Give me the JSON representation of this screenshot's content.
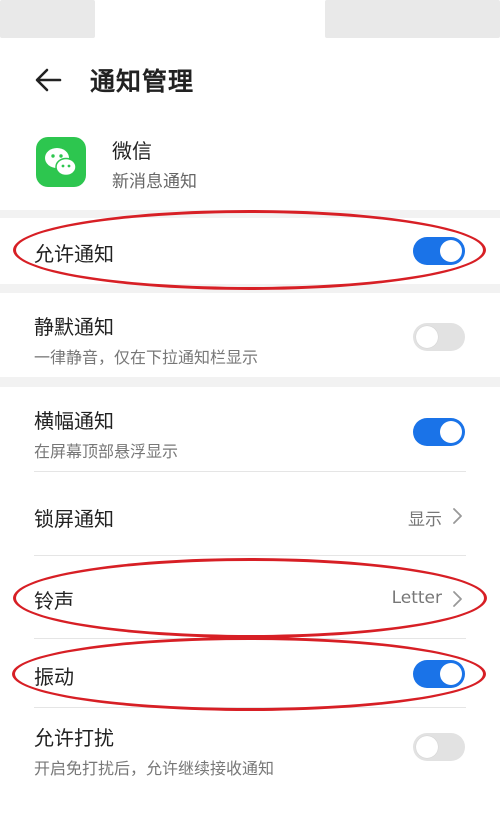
{
  "header": {
    "back_icon": "arrow-left-icon",
    "title": "通知管理"
  },
  "app": {
    "icon": "wechat-icon",
    "name": "微信",
    "subtitle": "新消息通知"
  },
  "settings": {
    "allow_notifications": {
      "label": "允许通知",
      "enabled": true
    },
    "silent": {
      "label": "静默通知",
      "subtitle": "一律静音，仅在下拉通知栏显示",
      "enabled": false
    },
    "banner": {
      "label": "横幅通知",
      "subtitle": "在屏幕顶部悬浮显示",
      "enabled": true
    },
    "lock_screen": {
      "label": "锁屏通知",
      "value": "显示"
    },
    "ringtone": {
      "label": "铃声",
      "value": "Letter"
    },
    "vibrate": {
      "label": "振动",
      "enabled": true
    },
    "allow_dnd": {
      "label": "允许打扰",
      "subtitle": "开启免打扰后，允许继续接收通知",
      "enabled": false
    }
  },
  "colors": {
    "toggle_on": "#1a73e8",
    "toggle_off": "#e2e2e2",
    "highlight": "#d71f25",
    "wechat_green": "#2dc64f"
  }
}
